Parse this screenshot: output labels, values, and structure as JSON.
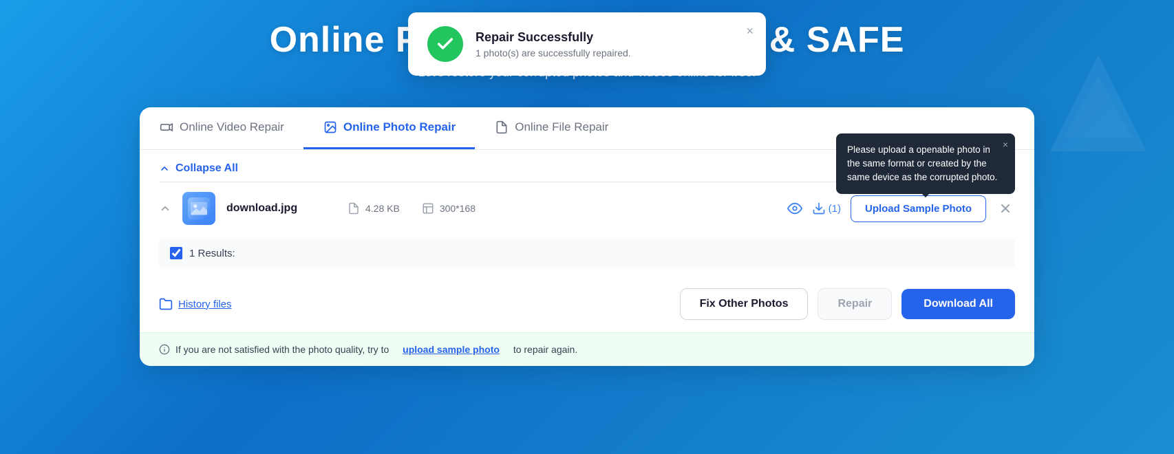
{
  "hero": {
    "title": "Online Photo Repair - FREE & SAFE",
    "subtitle": "Let's restore your corrupted photos and videos online for free!"
  },
  "toast": {
    "title": "Repair Successfully",
    "subtitle": "1 photo(s) are successfully repaired.",
    "close_label": "×"
  },
  "tabs": [
    {
      "id": "video",
      "label": "Online Video Repair",
      "active": false
    },
    {
      "id": "photo",
      "label": "Online Photo Repair",
      "active": true
    },
    {
      "id": "file",
      "label": "Online File Repair",
      "active": false
    }
  ],
  "collapse": {
    "label": "Collapse All"
  },
  "file": {
    "name": "download.jpg",
    "size": "4.28 KB",
    "dimensions": "300*168",
    "download_count": "(1)"
  },
  "tooltip": {
    "text": "Please upload a openable photo in the same format or created by the same device as the corrupted photo.",
    "close_label": "×"
  },
  "upload_sample_button": "Upload Sample Photo",
  "results": {
    "label": "1 Results:"
  },
  "actions": {
    "history_link": "History files",
    "fix_other": "Fix Other Photos",
    "repair": "Repair",
    "download_all": "Download All"
  },
  "info_bar": {
    "text_before": "If you are not satisfied with the photo quality, try to",
    "link_text": "upload sample photo",
    "text_after": "to repair again."
  }
}
